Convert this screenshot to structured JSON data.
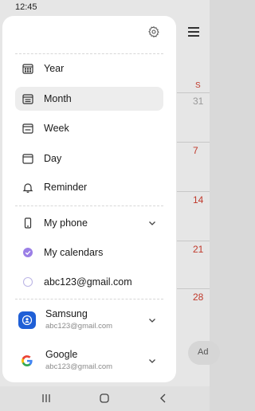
{
  "status_bar": {
    "time": "12:45"
  },
  "background": {
    "weekday_header": "S",
    "days": [
      "31",
      "7",
      "14",
      "21",
      "28"
    ],
    "add_label": "Ad"
  },
  "drawer": {
    "views": [
      {
        "label": "Year",
        "icon": "calendar-grid-icon",
        "selected": false
      },
      {
        "label": "Month",
        "icon": "calendar-month-icon",
        "selected": true
      },
      {
        "label": "Week",
        "icon": "calendar-week-icon",
        "selected": false
      },
      {
        "label": "Day",
        "icon": "calendar-day-icon",
        "selected": false
      },
      {
        "label": "Reminder",
        "icon": "bell-icon",
        "selected": false
      }
    ],
    "calendars": [
      {
        "label": "My phone",
        "icon": "phone-icon"
      },
      {
        "label": "My calendars",
        "icon": "check-circle-icon"
      },
      {
        "label": "abc123@gmail.com",
        "icon": "empty-circle-icon"
      }
    ],
    "accounts": [
      {
        "name": "Samsung",
        "email": "abc123@gmail.com",
        "icon": "samsung-account-icon"
      },
      {
        "name": "Google",
        "email": "abc123@gmail.com",
        "icon": "google-icon"
      }
    ]
  },
  "colors": {
    "selected_bg": "#ededed",
    "accent_purple": "#9b7fe6",
    "samsung_blue": "#1f5fd6",
    "sunday_red": "#c0392b"
  }
}
